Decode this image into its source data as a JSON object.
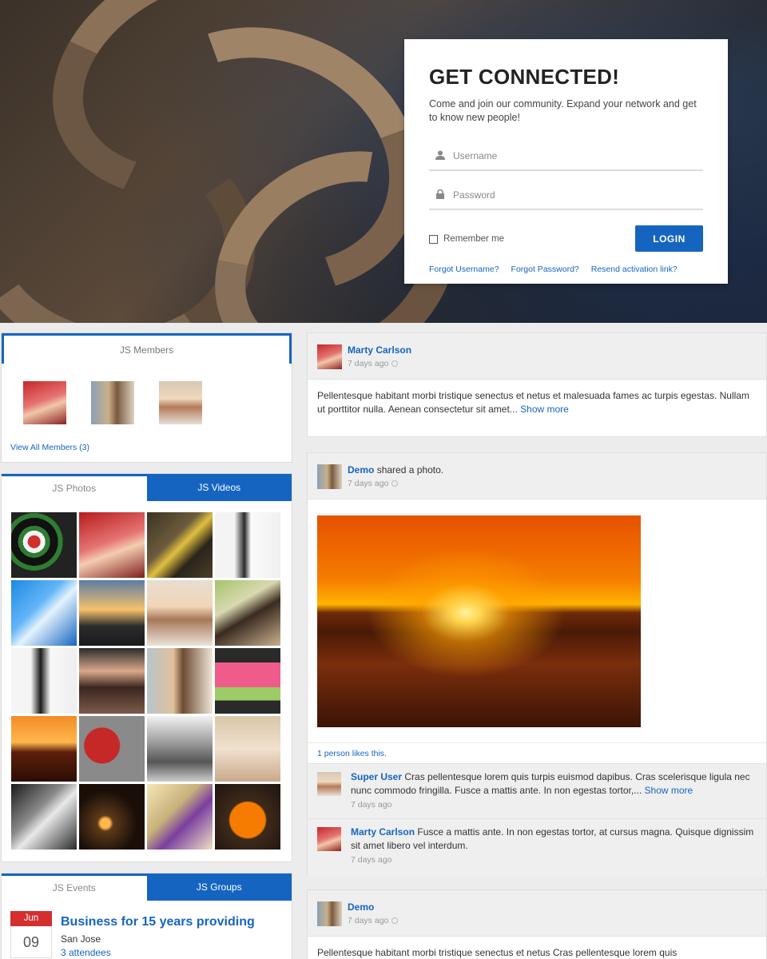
{
  "login": {
    "title": "GET CONNECTED!",
    "intro": "Come and join our community. Expand your network and get to know new people!",
    "username_placeholder": "Username",
    "password_placeholder": "Password",
    "remember": "Remember me",
    "login_button": "LOGIN",
    "links": [
      "Forgot Username?",
      "Forgot Password?",
      "Resend activation link?"
    ]
  },
  "members": {
    "title": "JS Members",
    "view_all": "View All Members (3)"
  },
  "media": {
    "tab_photos": "JS Photos",
    "tab_videos": "JS Videos"
  },
  "events": {
    "tab_events": "JS Events",
    "tab_groups": "JS Groups",
    "month": "Jun",
    "day": "09",
    "title": "Business for 15 years providing",
    "location": "San Jose",
    "attendees": "3 attendees"
  },
  "stream": {
    "post1": {
      "author": "Marty Carlson",
      "time": "7 days ago",
      "text": "Pellentesque habitant morbi tristique senectus et netus et malesuada fames ac turpis egestas. Nullam ut porttitor nulla. Aenean consectetur sit amet...",
      "show_more": "Show more"
    },
    "post2": {
      "author": "Demo",
      "action": "shared a photo.",
      "time": "7 days ago",
      "likes": "1 person likes this.",
      "comment1": {
        "author": "Super User",
        "text": "Cras pellentesque lorem quis turpis euismod dapibus. Cras scelerisque ligula nec nunc commodo fringilla. Fusce a mattis ante. In non egestas tortor,...",
        "show_more": "Show more",
        "time": "7 days ago"
      },
      "comment2": {
        "author": "Marty Carlson",
        "text": "Fusce a mattis ante. In non egestas tortor, at cursus magna. Quisque dignissim sit amet libero vel interdum.",
        "time": "7 days ago"
      }
    },
    "post3": {
      "author": "Demo",
      "time": "7 days ago",
      "text": "Pellentesque habitant morbi tristique senectus et netus Cras pellentesque lorem quis"
    }
  },
  "colors": {
    "accent": "#1565c0",
    "event_month": "#d32f2f"
  }
}
